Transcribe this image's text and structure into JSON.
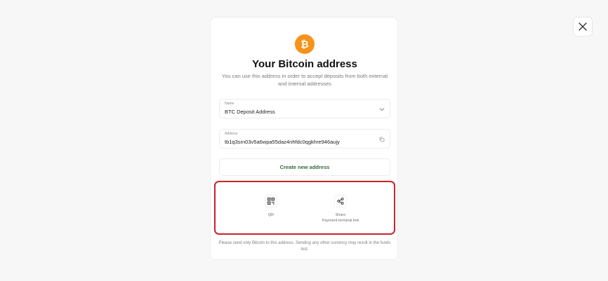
{
  "close": {
    "icon": "close-icon"
  },
  "header": {
    "logo_icon": "bitcoin-icon",
    "title": "Your Bitcoin address",
    "subtitle": "You can use this address in order to accept deposits from both external and internal addresses"
  },
  "name_field": {
    "label": "Name",
    "value": "BTC Deposit Address",
    "icon": "chevron-down-icon"
  },
  "address_field": {
    "label": "Address",
    "value": "tb1q3srn03v5a6wpa55daz4nhfdc0qgkhre946aujy",
    "icon": "copy-icon"
  },
  "create_button": {
    "label": "Create new address"
  },
  "actions": {
    "qr": {
      "label": "QR",
      "icon": "qr-code-icon"
    },
    "share": {
      "label": "Share",
      "sublabel": "Payment terminal link",
      "icon": "share-icon"
    }
  },
  "footer": {
    "note": "Please send only Bitcoin to this address. Sending any other currency may result in the funds lost."
  },
  "colors": {
    "bitcoin_orange": "#f7931a",
    "highlight_red": "#c8232c",
    "create_green": "#2f6a3a"
  }
}
